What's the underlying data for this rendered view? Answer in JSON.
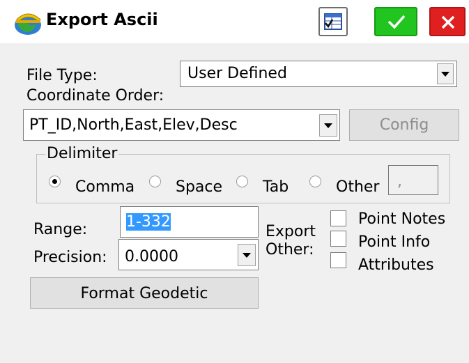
{
  "window": {
    "title": "Export Ascii",
    "app_icon": "carlson-globe-icon",
    "buttons": {
      "table_icon": "table-view-icon",
      "ok_icon": "checkmark-icon",
      "close_icon": "close-x-icon"
    }
  },
  "form": {
    "file_type_label": "File Type:",
    "file_type_value": "User Defined",
    "coord_order_label": "Coordinate Order:",
    "coord_order_value": "PT_ID,North,East,Elev,Desc",
    "config_button": "Config",
    "delimiter": {
      "legend": "Delimiter",
      "options": [
        "Comma",
        "Space",
        "Tab",
        "Other"
      ],
      "selected": "Comma",
      "other_value": ","
    },
    "range_label": "Range:",
    "range_value": "1-332",
    "precision_label": "Precision:",
    "precision_value": "0.0000",
    "export_other_label_1": "Export",
    "export_other_label_2": "Other:",
    "export_options": [
      "Point Notes",
      "Point Info",
      "Attributes"
    ],
    "format_geodetic_button": "Format Geodetic"
  },
  "colors": {
    "ok_green": "#22c51f",
    "close_red": "#e02020",
    "selection_blue": "#3399ff",
    "disabled_text": "#8d8d8d"
  }
}
